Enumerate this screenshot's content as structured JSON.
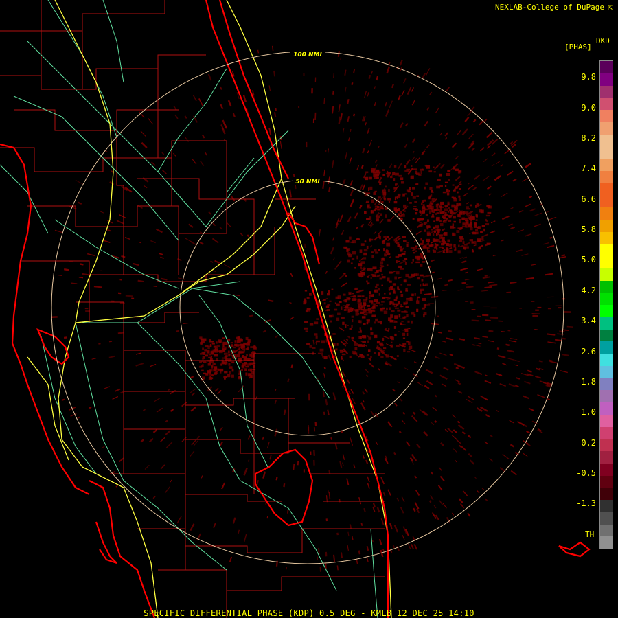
{
  "header": {
    "credit": "NEXLAB-College of DuPage"
  },
  "legend": {
    "units": "[PHAS]",
    "product_code": "DKD",
    "ticks": [
      "9.8",
      "9.0",
      "8.2",
      "7.4",
      "6.6",
      "5.8",
      "5.0",
      "4.2",
      "3.4",
      "2.6",
      "1.8",
      "1.0",
      "0.2",
      "-0.5",
      "-1.3"
    ],
    "threshold_label": "TH",
    "colors": [
      "#5a005a",
      "#800080",
      "#a0306e",
      "#d05070",
      "#f08060",
      "#f0a070",
      "#f0c090",
      "#f0c090",
      "#f0a060",
      "#f08040",
      "#f06020",
      "#f06020",
      "#f08010",
      "#f0a000",
      "#f8c000",
      "#ffff00",
      "#ffff00",
      "#c8ff00",
      "#00c000",
      "#00e000",
      "#00ff00",
      "#00c080",
      "#008040",
      "#00a0a0",
      "#40e0e0",
      "#60c0e0",
      "#8080c0",
      "#a070b0",
      "#c060c0",
      "#e060a0",
      "#d04070",
      "#c03050",
      "#a02040",
      "#800020",
      "#600010",
      "#400008",
      "#303030",
      "#505050",
      "#707070",
      "#909090"
    ]
  },
  "map": {
    "ring_labels": [
      "100 NMI",
      "50 NMI"
    ],
    "colors": {
      "coast": "#ff0000",
      "county": "#b01010",
      "highway": "#ffff40",
      "road": "#60e0a0",
      "ring": "#e8c8a0",
      "echo": "#7a0000"
    }
  },
  "footer": {
    "caption": "SPECIFIC DIFFERENTIAL PHASE (KDP) 0.5 DEG - KMLB 12 DEC 25 14:10"
  }
}
